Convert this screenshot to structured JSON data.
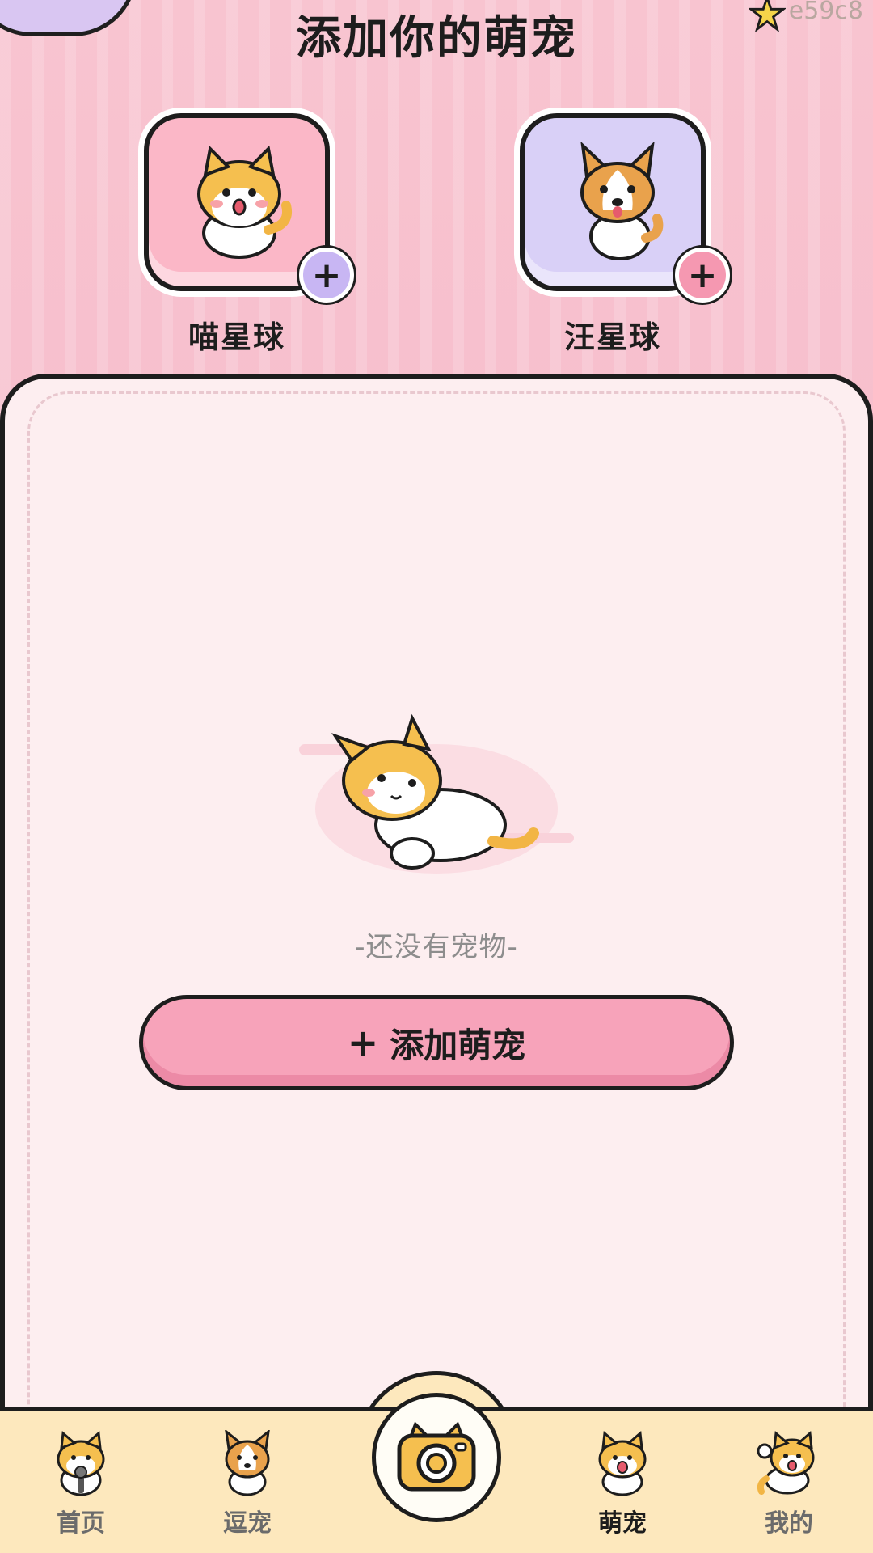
{
  "header": {
    "title": "添加你的萌宠",
    "corner_badge": "e59c8"
  },
  "planets": [
    {
      "label": "喵星球",
      "add_symbol": "+",
      "icon": "cat-icon"
    },
    {
      "label": "汪星球",
      "add_symbol": "+",
      "icon": "corgi-icon"
    }
  ],
  "empty_state": {
    "text": "-还没有宠物-",
    "add_button": {
      "plus": "+",
      "label": "添加萌宠"
    }
  },
  "tabbar": {
    "tabs": [
      {
        "label": "首页",
        "icon": "cat-microphone-icon",
        "active": false
      },
      {
        "label": "逗宠",
        "icon": "corgi-icon",
        "active": false
      },
      {
        "label": "",
        "icon": "camera-icon",
        "active": false
      },
      {
        "label": "萌宠",
        "icon": "cat-happy-icon",
        "active": true
      },
      {
        "label": "我的",
        "icon": "cat-wave-icon",
        "active": false
      }
    ]
  },
  "colors": {
    "background": "#f9c6d3",
    "panel": "#fdeef0",
    "button": "#f7a3ba",
    "tabbar": "#fde8bd",
    "cat_frame": "#fbb7c7",
    "dog_frame": "#d9d0f7"
  }
}
